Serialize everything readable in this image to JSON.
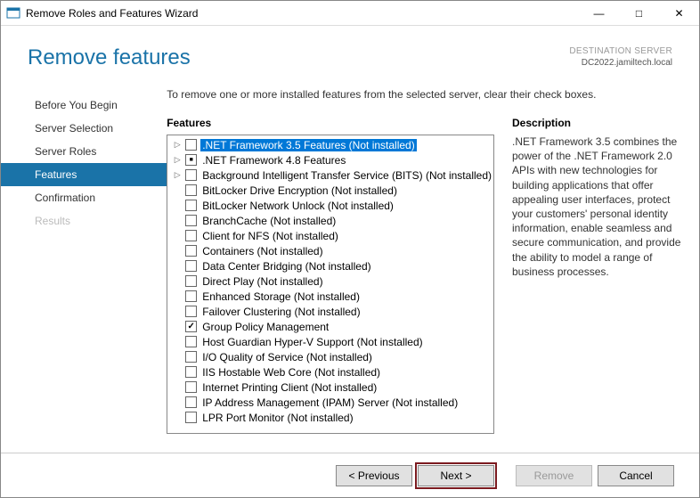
{
  "window": {
    "title": "Remove Roles and Features Wizard"
  },
  "header": {
    "title": "Remove features",
    "dest_label": "DESTINATION SERVER",
    "dest_value": "DC2022.jamiltech.local"
  },
  "sidebar": {
    "items": [
      {
        "label": "Before You Begin",
        "state": "normal"
      },
      {
        "label": "Server Selection",
        "state": "normal"
      },
      {
        "label": "Server Roles",
        "state": "normal"
      },
      {
        "label": "Features",
        "state": "active"
      },
      {
        "label": "Confirmation",
        "state": "normal"
      },
      {
        "label": "Results",
        "state": "disabled"
      }
    ]
  },
  "main": {
    "instruction": "To remove one or more installed features from the selected server, clear their check boxes.",
    "features_heading": "Features",
    "description_heading": "Description",
    "description_text": ".NET Framework 3.5 combines the power of the .NET Framework 2.0 APIs with new technologies for building applications that offer appealing user interfaces, protect your customers' personal identity information, enable seamless and secure communication, and provide the ability to model a range of business processes.",
    "features": [
      {
        "expand": "▷",
        "check": "none",
        "label": ".NET Framework 3.5 Features (Not installed)",
        "selected": true
      },
      {
        "expand": "▷",
        "check": "partial",
        "label": ".NET Framework 4.8 Features"
      },
      {
        "expand": "▷",
        "check": "none",
        "label": "Background Intelligent Transfer Service (BITS) (Not installed)"
      },
      {
        "expand": "",
        "check": "none",
        "label": "BitLocker Drive Encryption (Not installed)"
      },
      {
        "expand": "",
        "check": "none",
        "label": "BitLocker Network Unlock (Not installed)"
      },
      {
        "expand": "",
        "check": "none",
        "label": "BranchCache (Not installed)"
      },
      {
        "expand": "",
        "check": "none",
        "label": "Client for NFS (Not installed)"
      },
      {
        "expand": "",
        "check": "none",
        "label": "Containers (Not installed)"
      },
      {
        "expand": "",
        "check": "none",
        "label": "Data Center Bridging (Not installed)"
      },
      {
        "expand": "",
        "check": "none",
        "label": "Direct Play (Not installed)"
      },
      {
        "expand": "",
        "check": "none",
        "label": "Enhanced Storage (Not installed)"
      },
      {
        "expand": "",
        "check": "none",
        "label": "Failover Clustering (Not installed)"
      },
      {
        "expand": "",
        "check": "checked",
        "label": "Group Policy Management"
      },
      {
        "expand": "",
        "check": "none",
        "label": "Host Guardian Hyper-V Support (Not installed)"
      },
      {
        "expand": "",
        "check": "none",
        "label": "I/O Quality of Service (Not installed)"
      },
      {
        "expand": "",
        "check": "none",
        "label": "IIS Hostable Web Core (Not installed)"
      },
      {
        "expand": "",
        "check": "none",
        "label": "Internet Printing Client (Not installed)"
      },
      {
        "expand": "",
        "check": "none",
        "label": "IP Address Management (IPAM) Server (Not installed)"
      },
      {
        "expand": "",
        "check": "none",
        "label": "LPR Port Monitor (Not installed)"
      }
    ]
  },
  "footer": {
    "previous": "< Previous",
    "next": "Next >",
    "remove": "Remove",
    "cancel": "Cancel"
  }
}
